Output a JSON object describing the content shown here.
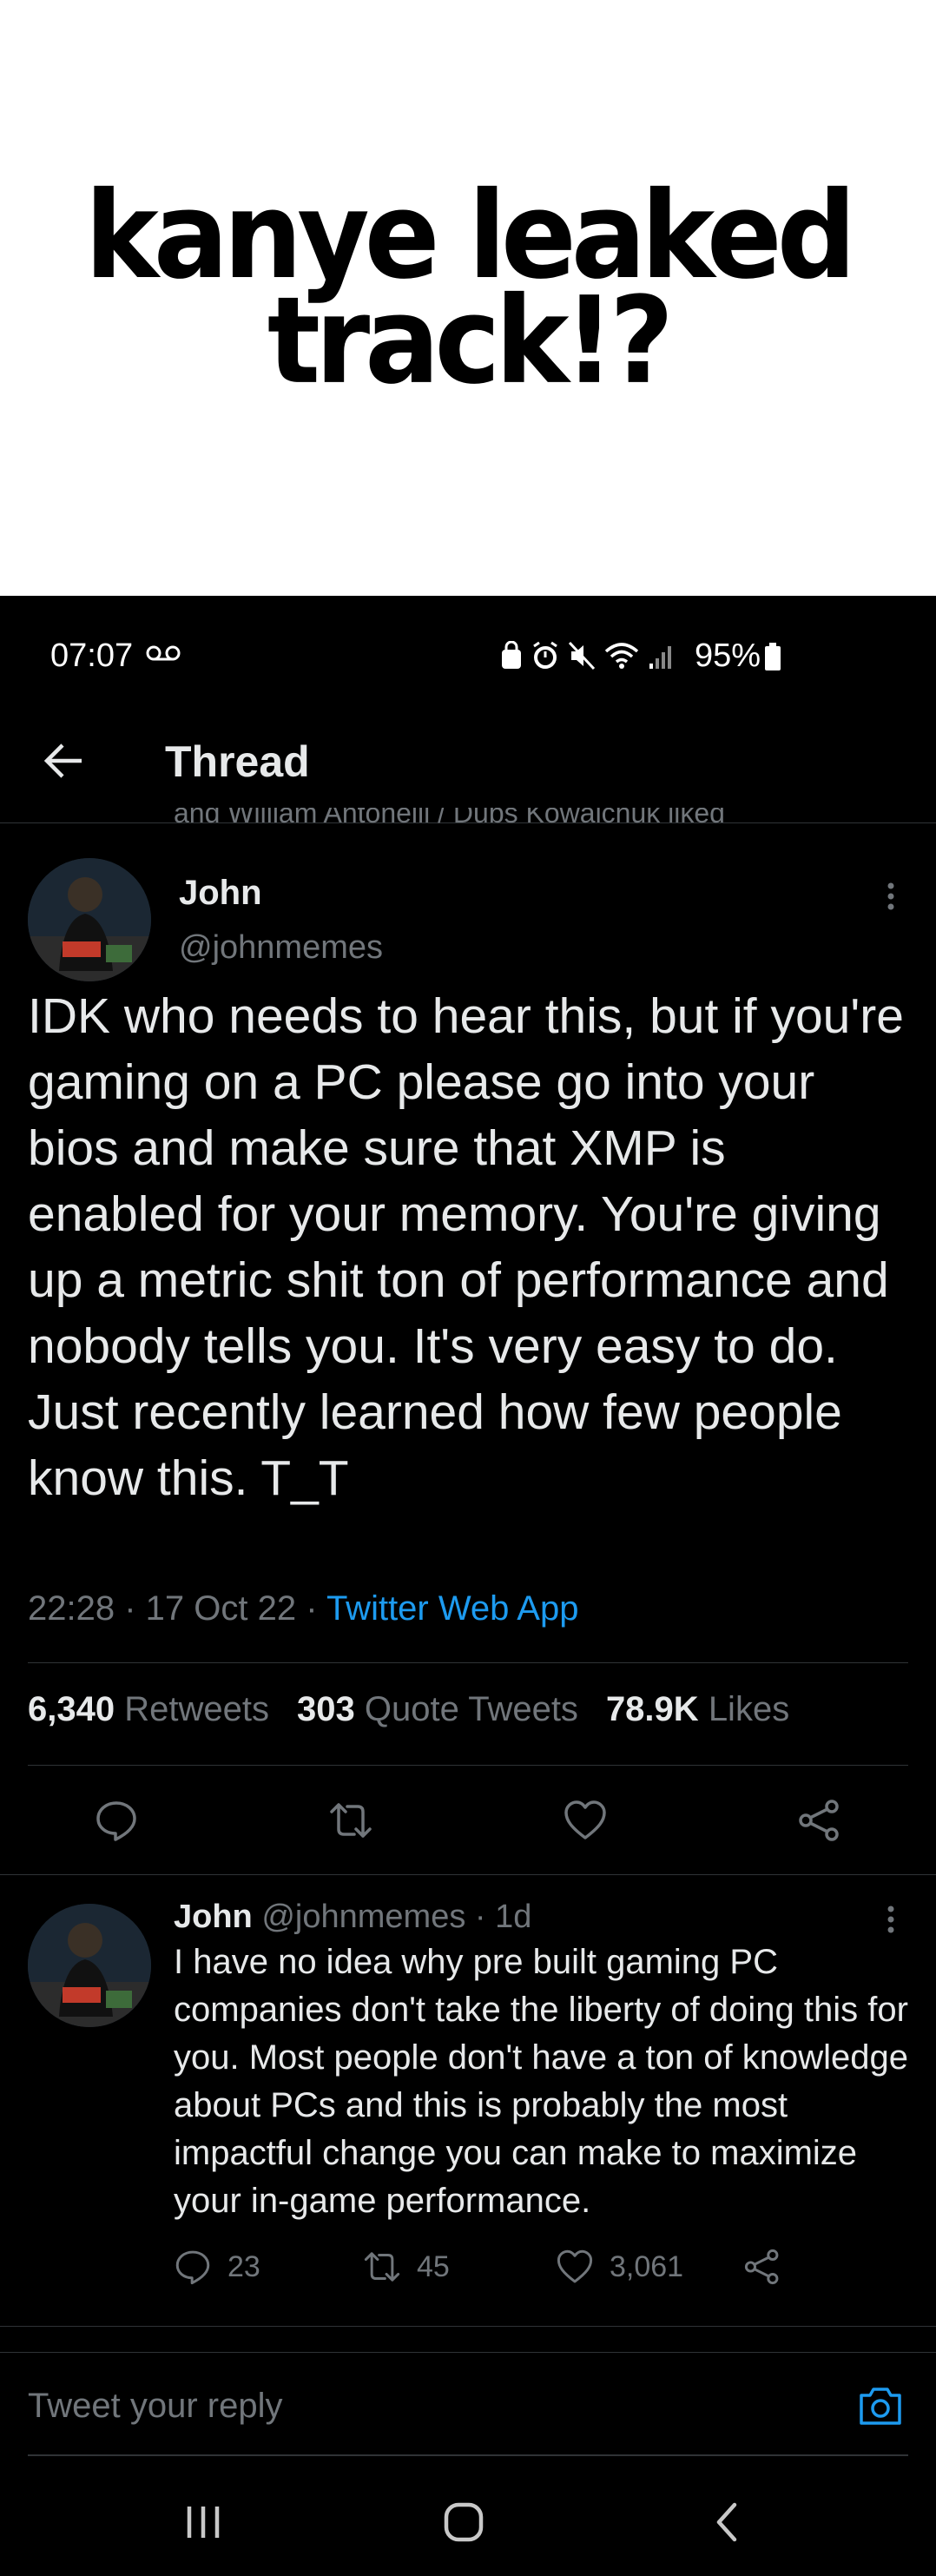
{
  "caption": {
    "text": "kanye leaked track!?"
  },
  "status_bar": {
    "time": "07:07",
    "battery": "95%"
  },
  "header": {
    "title": "Thread",
    "liked_strip": "and William Antonelli / Dubs Kowalchuk liked"
  },
  "main_tweet": {
    "name": "John",
    "handle": "@johnmemes",
    "text": "IDK who needs to hear this, but if you're gaming on a PC please go into your bios and make sure that XMP is enabled for your memory. You're giving up a metric shit ton of performance and nobody tells you. It's very easy to do. Just recently learned how few people know this. T_T",
    "time": "22:28",
    "date": "17 Oct 22",
    "source": "Twitter Web App",
    "stats": {
      "retweets_count": "6,340",
      "retweets_label": "Retweets",
      "quotes_count": "303",
      "quotes_label": "Quote Tweets",
      "likes_count": "78.9K",
      "likes_label": "Likes"
    }
  },
  "reply_tweet": {
    "name": "John",
    "handle": "@johnmemes",
    "age": "1d",
    "text": "I have no idea why pre built gaming PC companies don't take the liberty of doing this for you. Most people don't have a ton of knowledge about PCs and this is probably the most impactful change you can make to maximize your in-game performance.",
    "replies": "23",
    "retweets": "45",
    "likes": "3,061"
  },
  "composer": {
    "placeholder": "Tweet your reply"
  },
  "colors": {
    "accent": "#1d9bf0",
    "muted": "#71767b",
    "text": "#e7e9ea",
    "background": "#000000"
  },
  "icons": [
    "back-arrow-icon",
    "more-icon",
    "reply-icon",
    "retweet-icon",
    "like-icon",
    "share-icon",
    "camera-icon",
    "voicemail-icon",
    "wifi-icon",
    "alarm-icon",
    "mute-icon",
    "signal-icon",
    "battery-icon"
  ]
}
